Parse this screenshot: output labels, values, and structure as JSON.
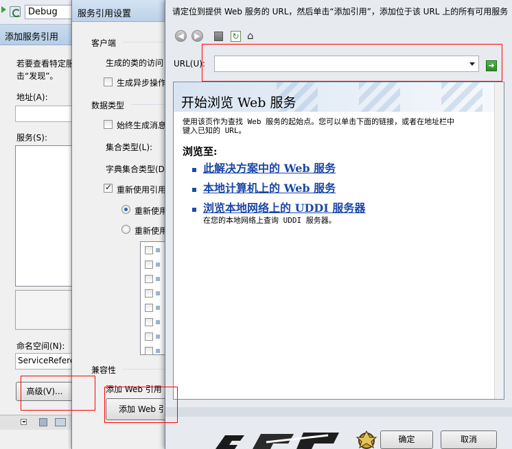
{
  "ide": {
    "config_value": "Debug"
  },
  "add_service_dialog": {
    "title": "添加服务引用",
    "description_line1": "若要查看特定服",
    "description_line2": "击“发现”。",
    "address_label": "地址(A):",
    "services_label": "服务(S):",
    "namespace_label": "命名空间(N):",
    "namespace_value": "ServiceRefere",
    "advanced_button": "高级(V)..."
  },
  "settings_dialog": {
    "title": "服务引用设置",
    "client_group": "客户端",
    "access_level_label": "生成的类的访问",
    "async_label": "生成异步操作",
    "data_type_group": "数据类型",
    "always_gen_label": "始终生成消息",
    "collection_type_label": "集合类型(L):",
    "dict_collection_label": "字典集合类型(D",
    "reuse_label": "重新使用引用",
    "reuse_all_label": "重新使用",
    "reuse_specified_label": "重新使用",
    "assembly_rows": 8,
    "compat_group": "兼容性",
    "compat_desc": "添加 Web 引用",
    "add_web_ref_button": "添加 Web 引"
  },
  "web_ref_dialog": {
    "instruction": "请定位到提供 Web 服务的 URL，然后单击“添加引用”，添加位于该 URL 上的所有可用服务",
    "url_label": "URL(U):",
    "url_value": "",
    "browser": {
      "title": "开始浏览 Web 服务",
      "intro_line1": "使用该页作为查找 Web 服务的起始点。您可以单击下面的链接，或者在地址栏中",
      "intro_line2": "键入已知的 URL。",
      "browse_heading": "浏览至:",
      "links": [
        "此解决方案中的 Web 服务",
        "本地计算机上的 Web 服务",
        "浏览本地网络上的 UDDI 服务器"
      ],
      "uddi_subtext": "在您的本地网络上查询 UDDI 服务器。"
    },
    "ok_button": "确定",
    "cancel_button": "取消"
  },
  "colors": {
    "highlight_box": "#ff0000",
    "link": "#1b47a8",
    "dialog_bg": "#f0f0f0"
  },
  "icons": [
    "back-icon",
    "forward-icon",
    "stop-icon",
    "refresh-icon",
    "home-icon",
    "go-icon"
  ]
}
